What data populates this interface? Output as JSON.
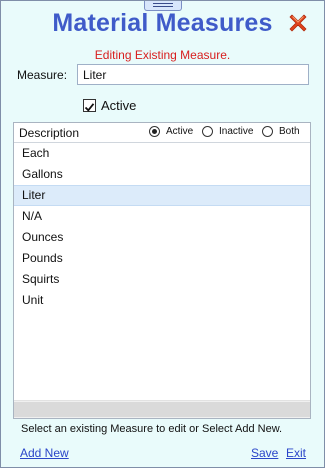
{
  "window": {
    "title": "Material Measures",
    "status": "Editing Existing Measure."
  },
  "form": {
    "measure_label": "Measure:",
    "measure_value": "Liter",
    "active_label": "Active",
    "active_checked": true
  },
  "list": {
    "header": {
      "description": "Description",
      "filters": [
        {
          "label": "Active",
          "selected": true
        },
        {
          "label": "Inactive",
          "selected": false
        },
        {
          "label": "Both",
          "selected": false
        }
      ]
    },
    "items": [
      "Each",
      "Gallons",
      "Liter",
      "N/A",
      "Ounces",
      "Pounds",
      "Squirts",
      "Unit"
    ],
    "selected_item": "Liter"
  },
  "footer": {
    "hint": "Select an existing Measure to edit or Select Add New.",
    "add_new": "Add New",
    "save": "Save",
    "exit": "Exit"
  },
  "colors": {
    "title": "#3f5bc9",
    "status": "#d81e1e",
    "link": "#2a45c9",
    "selection": "#dcebfa"
  },
  "icons": {
    "close": "close-icon",
    "grip": "grip-handle-icon"
  }
}
